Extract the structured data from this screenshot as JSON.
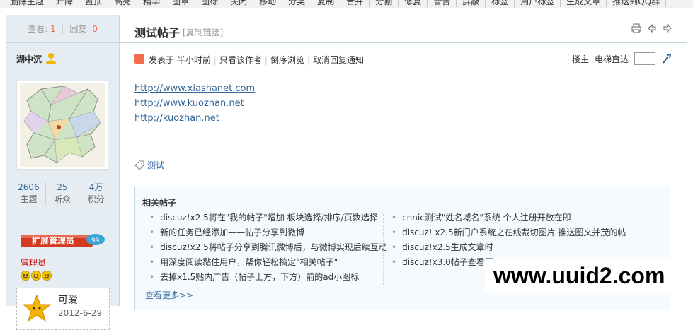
{
  "modbar": {
    "items": [
      "删除主题",
      "升降",
      "置顶",
      "高亮",
      "精华",
      "图章",
      "图标",
      "关闭",
      "移动",
      "分类",
      "复制",
      "合并",
      "分割",
      "修复",
      "警告",
      "屏蔽",
      "标签",
      "用户标签",
      "生成文章",
      "推送到QQ群"
    ]
  },
  "left": {
    "views_label": "查看:",
    "views": "1",
    "replies_label": "回复:",
    "replies": "0",
    "author": "湖中沉",
    "stats": [
      {
        "value": "2606",
        "label": "主题"
      },
      {
        "value": "25",
        "label": "听众"
      },
      {
        "value": "4万",
        "label": "积分"
      }
    ],
    "rank": "扩展管理员",
    "group": "管理员",
    "medal_name": "可爱",
    "medal_date": "2012-6-29"
  },
  "thread": {
    "title": "测试帖子",
    "copy_link": "[复制链接]",
    "posted": "发表于 半小时前",
    "only_author": "只看该作者",
    "reverse": "倒序浏览",
    "cancel_notify": "取消回复通知",
    "floor_label": "楼主",
    "jump_label": "电梯直达",
    "links": [
      "http://www.xiashanet.com",
      "http://www.kuozhan.net",
      "http://kuozhan.net"
    ],
    "tag": "测试"
  },
  "related": {
    "title": "相关帖子",
    "col1": [
      "discuz!x2.5将在\"我的帖子\"增加 板块选择/排序/页数选择",
      "新的任务已经添加——帖子分享到微博",
      "discuz!x2.5将帖子分享到腾讯微博后，与微博实现后续互动",
      "用深度阅读黏住用户，帮你轻松搞定\"相关帖子\"",
      "去掉x1.5贴内广告（帖子上方，下方）前的ad小图标"
    ],
    "col2": [
      "cnnic测试\"姓名域名\"系统 个人注册开放在即",
      "discuz! x2.5新门户系统之在线裁切图片 推送图文并茂的帖",
      "discuz!x2.5生成文章时",
      "discuz!x3.0帖子查看页"
    ],
    "more": "查看更多>>"
  },
  "watermark": "www.uuid2.com",
  "colors": {
    "accent": "#336699",
    "sidebar_bg": "#e5edf2",
    "border": "#c2d5e3",
    "highlight": "#f26c4f"
  }
}
